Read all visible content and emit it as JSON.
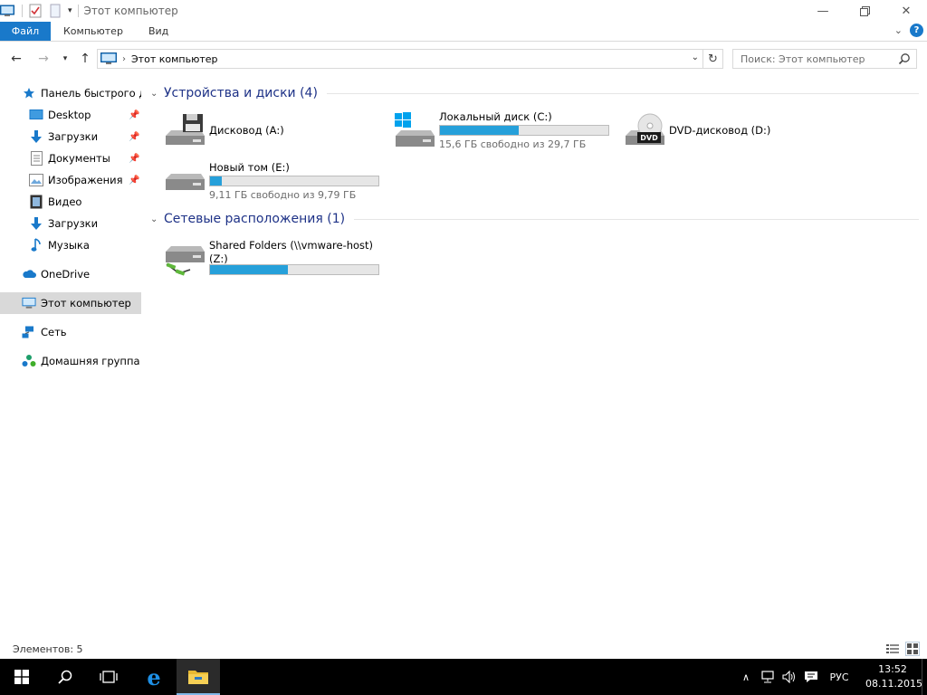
{
  "window": {
    "title": "Этот компьютер"
  },
  "ribbon": {
    "tabs": [
      "Файл",
      "Компьютер",
      "Вид"
    ],
    "help_label": "?"
  },
  "navigation": {
    "address_crumb": "Этот компьютер",
    "search_placeholder": "Поиск: Этот компьютер"
  },
  "sidebar": {
    "items": [
      {
        "label": "Панель быстрого доступа",
        "icon": "star-icon"
      },
      {
        "label": "Desktop",
        "icon": "desktop-icon",
        "pinned": true
      },
      {
        "label": "Загрузки",
        "icon": "download-icon",
        "pinned": true
      },
      {
        "label": "Документы",
        "icon": "document-icon",
        "pinned": true
      },
      {
        "label": "Изображения",
        "icon": "pictures-icon",
        "pinned": true
      },
      {
        "label": "Видео",
        "icon": "video-icon"
      },
      {
        "label": "Загрузки",
        "icon": "download-icon"
      },
      {
        "label": "Музыка",
        "icon": "music-icon"
      },
      {
        "label": "OneDrive",
        "icon": "cloud-icon"
      },
      {
        "label": "Этот компьютер",
        "icon": "computer-icon",
        "selected": true
      },
      {
        "label": "Сеть",
        "icon": "network-icon"
      },
      {
        "label": "Домашняя группа",
        "icon": "homegroup-icon"
      }
    ]
  },
  "content": {
    "groups": [
      {
        "title": "Устройства и диски (4)"
      },
      {
        "title": "Сетевые расположения (1)"
      }
    ],
    "drives": [
      {
        "name": "Дисковод (A:)",
        "icon": "floppy-drive-icon"
      },
      {
        "name": "Локальный диск (C:)",
        "free_text": "15,6 ГБ свободно из 29,7 ГБ",
        "used_fraction": 0.47,
        "icon": "windows-drive-icon"
      },
      {
        "name": "DVD-дисковод (D:)",
        "icon": "dvd-drive-icon",
        "badge": "DVD"
      },
      {
        "name": "Новый том (E:)",
        "free_text": "9,11 ГБ свободно из 9,79 ГБ",
        "used_fraction": 0.07,
        "icon": "hard-drive-icon"
      },
      {
        "name_line1": "Shared Folders (\\\\vmware-host)",
        "name_line2": "(Z:)",
        "used_fraction": 0.46,
        "icon": "network-drive-icon"
      }
    ]
  },
  "status": {
    "text": "Элементов: 5"
  },
  "taskbar": {
    "language": "РУС",
    "time": "13:52",
    "date": "08.11.2015"
  },
  "colors": {
    "accent": "#1979ca",
    "progress": "#26a0da",
    "group_title": "#1e3287"
  }
}
